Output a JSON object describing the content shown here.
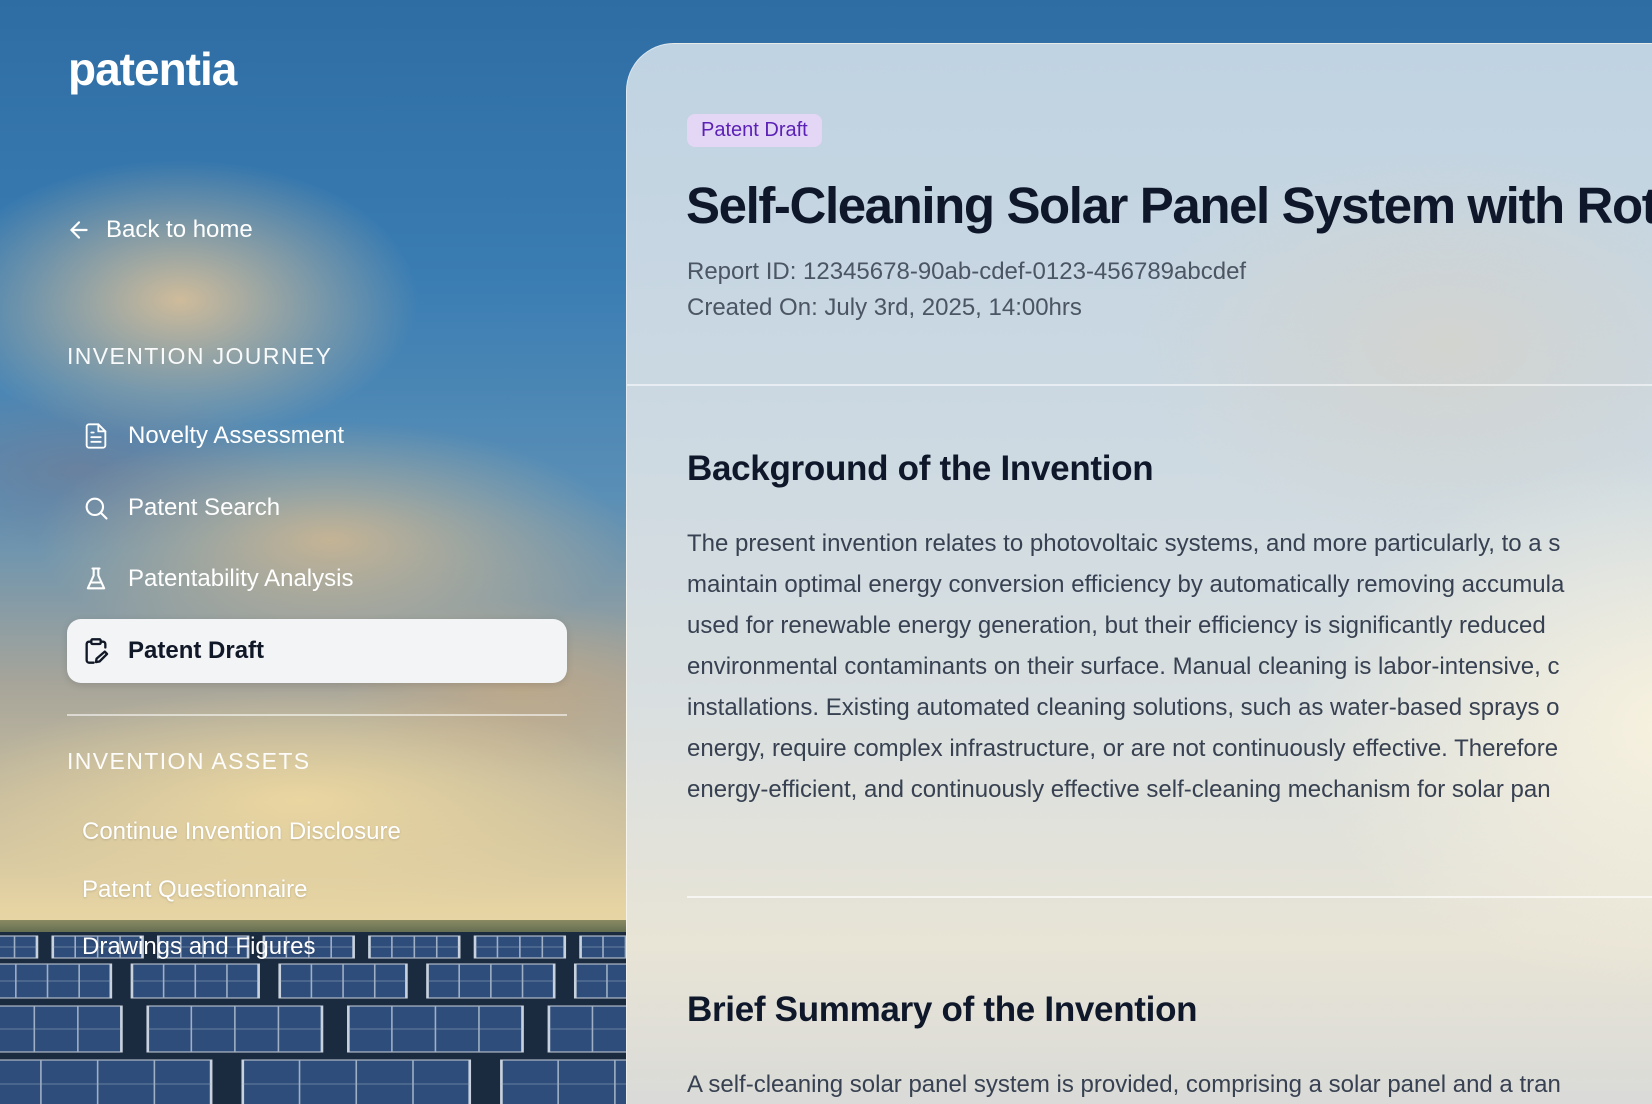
{
  "app": {
    "logo": "patentia"
  },
  "sidebar": {
    "back_label": "Back to home",
    "journey_label": "INVENTION JOURNEY",
    "journey_items": [
      {
        "label": "Novelty Assessment",
        "icon": "document-icon"
      },
      {
        "label": "Patent Search",
        "icon": "search-icon"
      },
      {
        "label": "Patentability Analysis",
        "icon": "flask-icon"
      },
      {
        "label": "Patent Draft",
        "icon": "edit-clipboard-icon",
        "active": true
      }
    ],
    "assets_label": "INVENTION ASSETS",
    "asset_links": [
      "Continue Invention Disclosure",
      "Patent Questionnaire",
      "Drawings and Figures"
    ]
  },
  "document": {
    "badge": "Patent Draft",
    "title": "Self-Cleaning Solar Panel System with Rot",
    "report_id": "Report ID: 12345678-90ab-cdef-0123-456789abcdef",
    "created_on": "Created On: July 3rd, 2025, 14:00hrs",
    "sections": [
      {
        "heading": "Background of the Invention",
        "lines": [
          "The present invention relates to photovoltaic systems, and more particularly, to a s",
          "maintain optimal energy conversion efficiency by automatically removing accumula",
          "used for renewable energy generation, but their efficiency is significantly reduced",
          "environmental contaminants on their surface. Manual cleaning is labor-intensive, c",
          "installations. Existing automated cleaning solutions, such as water-based sprays o",
          "energy, require complex infrastructure, or are not continuously effective. Therefore",
          "energy-efficient, and continuously effective self-cleaning mechanism for solar pan"
        ]
      },
      {
        "heading": "Brief Summary of the Invention",
        "lines": [
          "A self-cleaning solar panel system is provided, comprising a solar panel and a tran"
        ]
      }
    ]
  },
  "colors": {
    "badge_bg": "#e4d6f5",
    "badge_text": "#5b21b6",
    "active_nav_bg": "#f3f4f6",
    "title_text": "#0f172a"
  }
}
